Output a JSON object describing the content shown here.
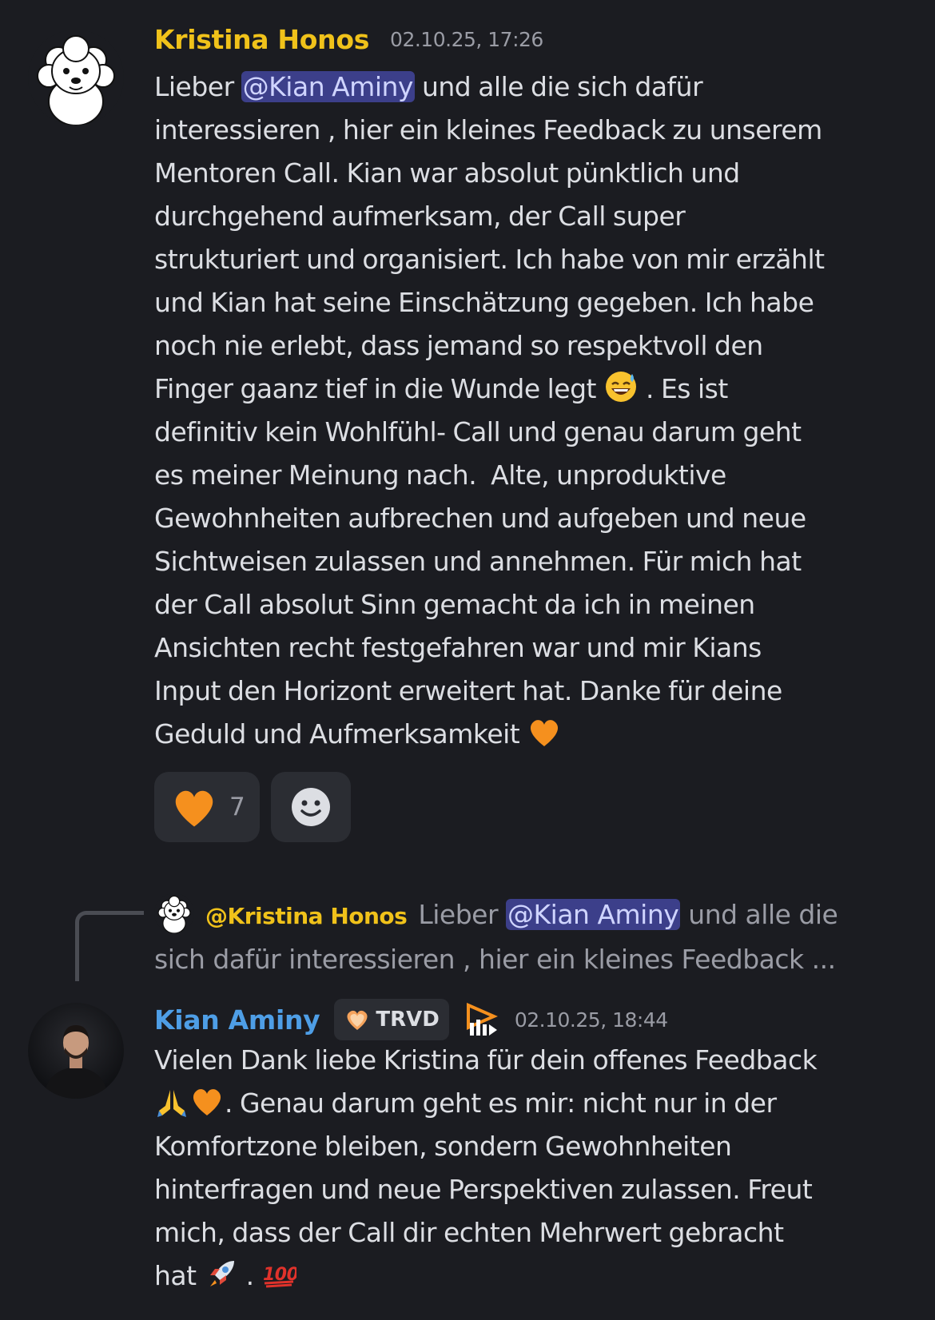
{
  "messages": [
    {
      "author": "Kristina Honos",
      "author_color": "#f0c21a",
      "avatar": "poodle-avatar",
      "timestamp": "02.10.25, 17:26",
      "mention": "@Kian Aminy",
      "lines": [
        "Lieber ",
        " und alle die sich dafür",
        "interessieren , hier ein kleines Feedback zu unserem",
        "Mentoren Call. Kian war absolut pünktlich und",
        "durchgehend aufmerksam, der Call super",
        "strukturiert und organisiert. Ich habe von mir erzählt",
        "und Kian hat seine Einschätzung gegeben. Ich habe",
        "noch nie erlebt, dass jemand so respektvoll den",
        "Finger gaanz tief in die Wunde legt ",
        " . Es ist",
        "definitiv kein Wohlfühl- Call und genau darum geht",
        "es meiner Meinung nach.  Alte, unproduktive",
        "Gewohnheiten aufbrechen und aufgeben und neue",
        "Sichtweisen zulassen und annehmen. Für mich hat",
        "der Call absolut Sinn gemacht da ich in meinen",
        "Ansichten recht festgefahren war und mir Kians",
        "Input den Horizont erweitert hat. Danke für deine",
        "Geduld und Aufmerksamkeit "
      ],
      "reactions": [
        {
          "emoji": "orange-heart",
          "count": "7"
        },
        {
          "emoji": "add-reaction-icon",
          "count": ""
        }
      ]
    },
    {
      "author": "Kian Aminy",
      "author_color": "#4e9ee6",
      "avatar": "man-photo-avatar",
      "timestamp": "02.10.25, 18:44",
      "badge": "TRVD",
      "reply_to": {
        "author": "@Kristina Honos",
        "pre": "Lieber ",
        "mention": "@Kian Aminy",
        "post": " und alle die",
        "line2": "sich dafür interessieren , hier ein kleines Feedback ..."
      },
      "lines": [
        "Vielen Dank liebe Kristina für dein offenes Feedback",
        ". Genau darum geht es mir: nicht nur in der",
        "Komfortzone bleiben, sondern Gewohnheiten",
        "hinterfragen und neue Perspektiven zulassen. Freut",
        "mich, dass der Call dir echten Mehrwert gebracht",
        "hat ",
        " . "
      ]
    }
  ]
}
